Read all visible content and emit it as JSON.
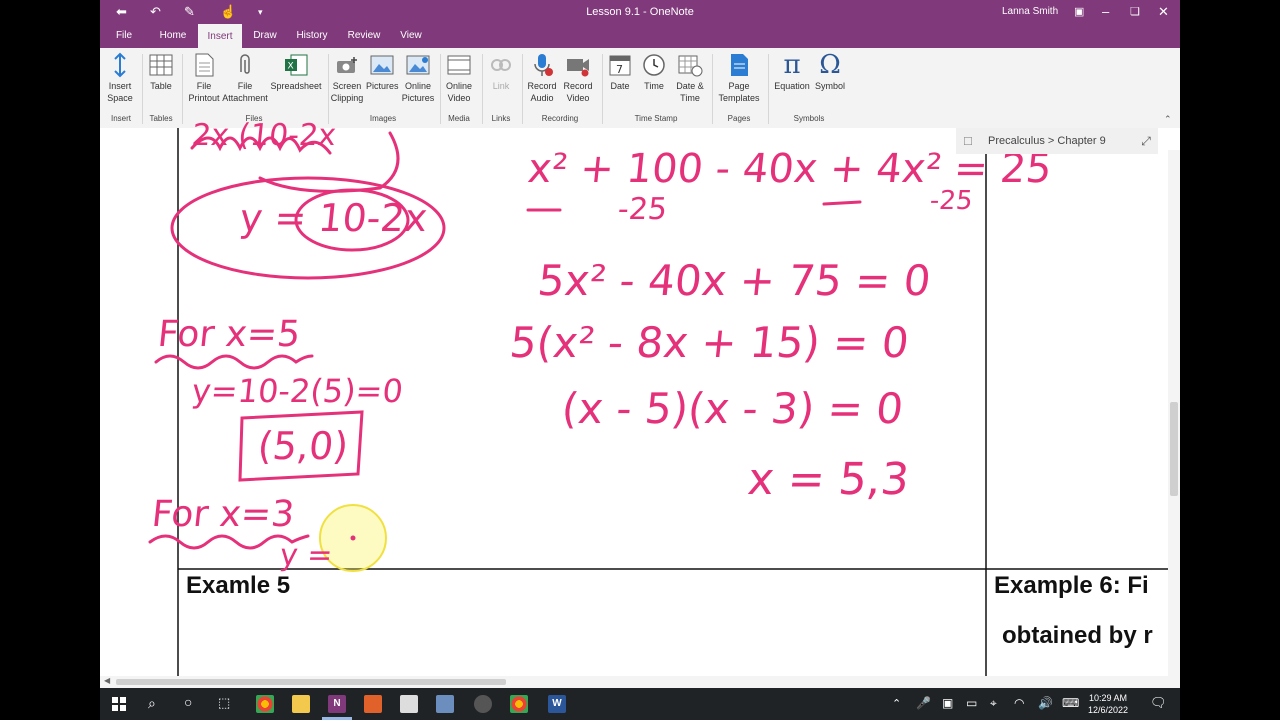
{
  "window": {
    "title": "Lesson 9.1  -  OneNote",
    "user": "Lanna Smith"
  },
  "tabs": [
    "File",
    "Home",
    "Insert",
    "Draw",
    "History",
    "Review",
    "View"
  ],
  "active_tab": "Insert",
  "ribbon": {
    "groups": [
      {
        "name": "Insert",
        "commands": [
          {
            "label": "Insert\nSpace",
            "icon": "insert-space-icon"
          }
        ]
      },
      {
        "name": "Tables",
        "commands": [
          {
            "label": "Table",
            "icon": "table-icon"
          }
        ]
      },
      {
        "name": "Files",
        "commands": [
          {
            "label": "File\nPrintout",
            "icon": "file-printout-icon"
          },
          {
            "label": "File\nAttachment",
            "icon": "paperclip-icon"
          },
          {
            "label": "Spreadsheet",
            "icon": "excel-icon"
          }
        ]
      },
      {
        "name": "Images",
        "commands": [
          {
            "label": "Screen\nClipping",
            "icon": "camera-icon"
          },
          {
            "label": "Pictures",
            "icon": "picture-icon"
          },
          {
            "label": "Online\nPictures",
            "icon": "online-picture-icon"
          }
        ]
      },
      {
        "name": "Media",
        "commands": [
          {
            "label": "Online\nVideo",
            "icon": "video-icon"
          }
        ]
      },
      {
        "name": "Links",
        "commands": [
          {
            "label": "Link",
            "icon": "link-icon"
          }
        ]
      },
      {
        "name": "Recording",
        "commands": [
          {
            "label": "Record\nAudio",
            "icon": "microphone-icon"
          },
          {
            "label": "Record\nVideo",
            "icon": "camcorder-icon"
          }
        ]
      },
      {
        "name": "Time Stamp",
        "commands": [
          {
            "label": "Date",
            "icon": "calendar-icon"
          },
          {
            "label": "Time",
            "icon": "clock-icon"
          },
          {
            "label": "Date &\nTime",
            "icon": "calendar-clock-icon"
          }
        ]
      },
      {
        "name": "Pages",
        "commands": [
          {
            "label": "Page\nTemplates",
            "icon": "page-icon"
          }
        ]
      },
      {
        "name": "Symbols",
        "commands": [
          {
            "label": "Equation",
            "icon": "pi-icon",
            "glyph": "π"
          },
          {
            "label": "Symbol",
            "icon": "omega-icon",
            "glyph": "Ω"
          }
        ]
      }
    ]
  },
  "breadcrumb": "Precalculus > Chapter 9",
  "examples": {
    "left": "Examle 5",
    "right_line1": "Example 6:  Fi",
    "right_line2": "obtained by r"
  },
  "ink": {
    "color": "#e5317a",
    "left": {
      "top_fragment": "2x   (10-2x",
      "y_eq": "y = 10-2x",
      "for5": "For x=5",
      "y5": "y=10-2(5)=0",
      "point5": "(5,0)",
      "for3": "For x=3",
      "y3": "y ="
    },
    "right": {
      "line1": "x² + 100 - 40x + 4x² = 25",
      "line1_sub": "-25",
      "line1_sub2": "-25",
      "line2": "5x² - 40x + 75 = 0",
      "line3": "5(x² - 8x + 15) = 0",
      "line4": "(x - 5)(x - 3) = 0",
      "line5": "x = 5,3"
    }
  },
  "taskbar": {
    "time": "10:29 AM",
    "date": "12/6/2022"
  }
}
